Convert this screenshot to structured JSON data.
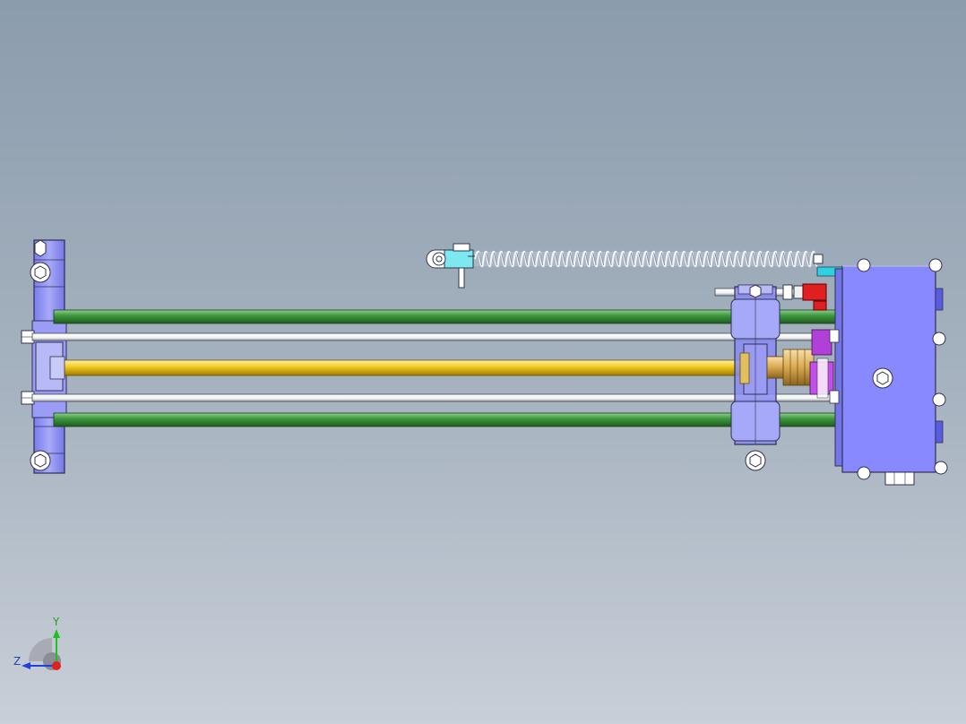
{
  "viewport": {
    "background_top": "#8b9cad",
    "background_bottom": "#c8cfd8"
  },
  "model": {
    "parts": [
      "left-end-plate",
      "guide-rod-top",
      "guide-rod-bottom",
      "tie-rod-top",
      "tie-rod-bottom",
      "lead-screw",
      "carriage-block",
      "coupling",
      "motor-housing",
      "tension-spring",
      "spring-clevis",
      "limit-switch"
    ],
    "colors": {
      "end_plate": "#8a8cf4",
      "guide_rod": "#3a8a3a",
      "tie_rod": "#ffffff",
      "lead_screw": "#e8c020",
      "motor_housing": "#8888ff",
      "spring": "#e8ecf4",
      "clevis": "#00d0e0",
      "limit_switch": "#e02020",
      "gear": "#c040e0"
    }
  },
  "triad": {
    "x_label": "Y",
    "z_label": "Z",
    "y_color": "#20c020",
    "z_color": "#2040e0",
    "origin_color": "#e02020"
  }
}
